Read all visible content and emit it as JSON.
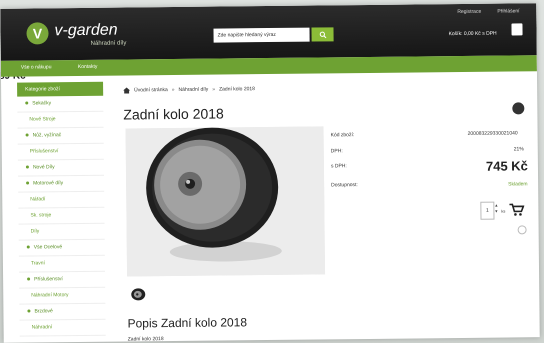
{
  "header": {
    "brand": "v-garden",
    "brand_sub": "Náhradní díly",
    "logo_letter": "V",
    "search_placeholder": "Zde napište hledaný výraz",
    "links": [
      "Registrace",
      "Přihlášení"
    ],
    "cart_text": "Košík: 0,00 Kč s DPH"
  },
  "edge_price": "89 Kč",
  "menu": [
    "Vše o nákupu",
    "Kontakty"
  ],
  "sidebar": {
    "heading": "Kategorie zboží",
    "items": [
      {
        "label": "Sekačky",
        "bullet": true,
        "sub": false
      },
      {
        "label": "Nové Stroje",
        "bullet": false,
        "sub": true
      },
      {
        "label": "Nůž, vyžínač",
        "bullet": true,
        "sub": false
      },
      {
        "label": "Příslušenství",
        "bullet": false,
        "sub": true
      },
      {
        "label": "Nové Díly",
        "bullet": true,
        "sub": false
      },
      {
        "label": "Motorové díly",
        "bullet": true,
        "sub": false
      },
      {
        "label": "Nářadí",
        "bullet": false,
        "sub": true
      },
      {
        "label": "Sk. stroje",
        "bullet": false,
        "sub": true
      },
      {
        "label": "Díly",
        "bullet": false,
        "sub": true
      },
      {
        "label": "Vše Ocelové",
        "bullet": true,
        "sub": false
      },
      {
        "label": "Travní",
        "bullet": false,
        "sub": true
      },
      {
        "label": "Příslušenství",
        "bullet": true,
        "sub": false
      },
      {
        "label": "Náhradní Motory",
        "bullet": false,
        "sub": true
      },
      {
        "label": "Brzdové",
        "bullet": true,
        "sub": false
      },
      {
        "label": "Náhradní",
        "bullet": false,
        "sub": true
      }
    ]
  },
  "breadcrumb": [
    "Úvodní stránka",
    "Náhradní díly",
    "Zadní kolo 2018"
  ],
  "product": {
    "title": "Zadní kolo 2018",
    "specs": [
      {
        "label": "Kód zboží:",
        "value": "200083229330021040"
      },
      {
        "label": "DPH:",
        "value": "21%"
      },
      {
        "label": "s DPH:",
        "value": "745 Kč"
      },
      {
        "label": "Dostupnost:",
        "value": "Skladem"
      }
    ],
    "qty": "1",
    "unit": "ks",
    "desc_title": "Popis Zadní kolo 2018",
    "desc_sub": "Zadní kolo 2018"
  },
  "colors": {
    "accent": "#6ea233",
    "topbar": "#1e1e1e"
  },
  "icons": [
    "search-icon",
    "cart-icon",
    "home-icon",
    "add-to-cart-icon",
    "compare-icon"
  ]
}
